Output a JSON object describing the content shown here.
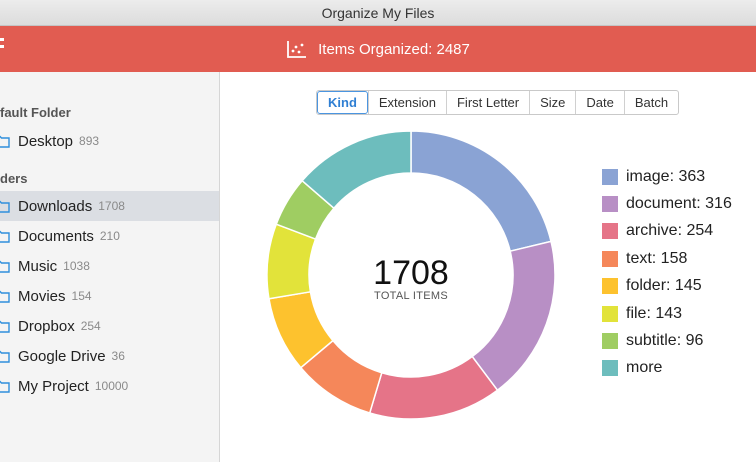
{
  "window": {
    "title": "Organize My Files"
  },
  "banner": {
    "items_label": "Items Organized: 2487"
  },
  "sidebar": {
    "default_folder_title": "fault Folder",
    "default_folder": {
      "name": "Desktop",
      "count": "893"
    },
    "folders_title": "ders",
    "folders": [
      {
        "name": "Downloads",
        "count": "1708",
        "selected": true
      },
      {
        "name": "Documents",
        "count": "210"
      },
      {
        "name": "Music",
        "count": "1038"
      },
      {
        "name": "Movies",
        "count": "154"
      },
      {
        "name": "Dropbox",
        "count": "254"
      },
      {
        "name": "Google Drive",
        "count": "36"
      },
      {
        "name": "My Project",
        "count": "10000"
      }
    ]
  },
  "tabs": [
    {
      "label": "Kind",
      "active": true
    },
    {
      "label": "Extension"
    },
    {
      "label": "First Letter"
    },
    {
      "label": "Size"
    },
    {
      "label": "Date"
    },
    {
      "label": "Batch"
    }
  ],
  "donut": {
    "total": "1708",
    "total_label": "TOTAL ITEMS"
  },
  "chart_data": {
    "type": "pie",
    "categories": [
      "image",
      "document",
      "archive",
      "text",
      "folder",
      "file",
      "subtitle",
      "more"
    ],
    "values": [
      363,
      316,
      254,
      158,
      145,
      143,
      96,
      233
    ],
    "labels": [
      "image: 363",
      "document: 316",
      "archive: 254",
      "text: 158",
      "folder: 145",
      "file: 143",
      "subtitle: 96",
      "more"
    ],
    "colors": [
      "#8aa3d4",
      "#b88fc5",
      "#e57488",
      "#f5875a",
      "#fdc22e",
      "#e2e33a",
      "#9fcd62",
      "#6dbdbd"
    ],
    "legend_position": "right"
  }
}
